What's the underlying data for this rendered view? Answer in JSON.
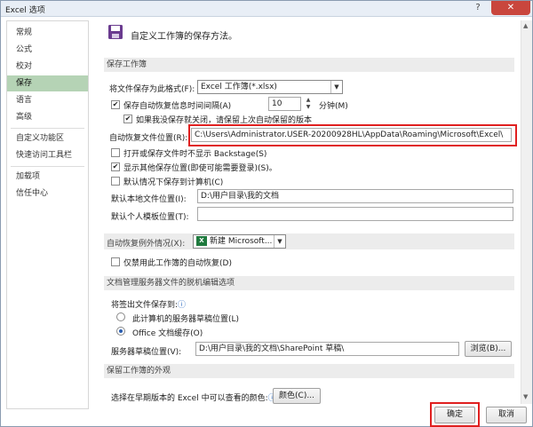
{
  "window": {
    "title": "Excel 选项",
    "help_glyph": "?",
    "close_glyph": "✕"
  },
  "sidebar": {
    "items": [
      {
        "label": "常规"
      },
      {
        "label": "公式"
      },
      {
        "label": "校对"
      },
      {
        "label": "保存"
      },
      {
        "label": "语言"
      },
      {
        "label": "高级"
      },
      {
        "label": "自定义功能区"
      },
      {
        "label": "快速访问工具栏"
      },
      {
        "label": "加载项"
      },
      {
        "label": "信任中心"
      }
    ],
    "active_index": 3
  },
  "header": {
    "text": "自定义工作簿的保存方法。"
  },
  "save_section": {
    "title": "保存工作簿",
    "format_label": "将文件保存为此格式(F):",
    "format_value": "Excel 工作簿(*.xlsx)",
    "autorecover_label": "保存自动恢复信息时间间隔(A)",
    "autorecover_checked": true,
    "autorecover_minutes": "10",
    "minutes_label": "分钟(M)",
    "keep_last_label": "如果我没保存就关闭，请保留上次自动保留的版本",
    "keep_last_checked": true,
    "autorecover_location_label": "自动恢复文件位置(R):",
    "autorecover_location_value": "C:\\Users\\Administrator.USER-20200928HL\\AppData\\Roaming\\Microsoft\\Excel\\",
    "backstage_label": "打开或保存文件时不显示 Backstage(S)",
    "backstage_checked": false,
    "show_places_label": "显示其他保存位置(即使可能需要登录)(S)。",
    "show_places_checked": true,
    "default_computer_label": "默认情况下保存到计算机(C)",
    "default_computer_checked": false,
    "default_local_label": "默认本地文件位置(I):",
    "default_local_value": "D:\\用户目录\\我的文档",
    "default_template_label": "默认个人模板位置(T):",
    "default_template_value": ""
  },
  "autorecover_exceptions": {
    "label": "自动恢复例外情况(X):",
    "workbook_value": "新建 Microsoft...",
    "disable_label": "仅禁用此工作簿的自动恢复(D)",
    "disable_checked": false
  },
  "offline_section": {
    "title": "文档管理服务器文件的脱机编辑选项",
    "save_to_label": "将签出文件保存到:",
    "option_server": "此计算机的服务器草稿位置(L)",
    "option_cache": "Office 文档缓存(O)",
    "selected": "cache",
    "drafts_label": "服务器草稿位置(V):",
    "drafts_value": "D:\\用户目录\\我的文档\\SharePoint 草稿\\",
    "browse_label": "浏览(B)..."
  },
  "appearance_section": {
    "title": "保留工作簿的外观",
    "colors_label": "选择在早期版本的 Excel 中可以查看的颜色:",
    "colors_button": "颜色(C)..."
  },
  "footer": {
    "ok_label": "确定",
    "cancel_label": "取消"
  },
  "colors": {
    "highlight": "#e02020",
    "active_nav": "#b5d3b5",
    "accent": "#2a5db0"
  }
}
